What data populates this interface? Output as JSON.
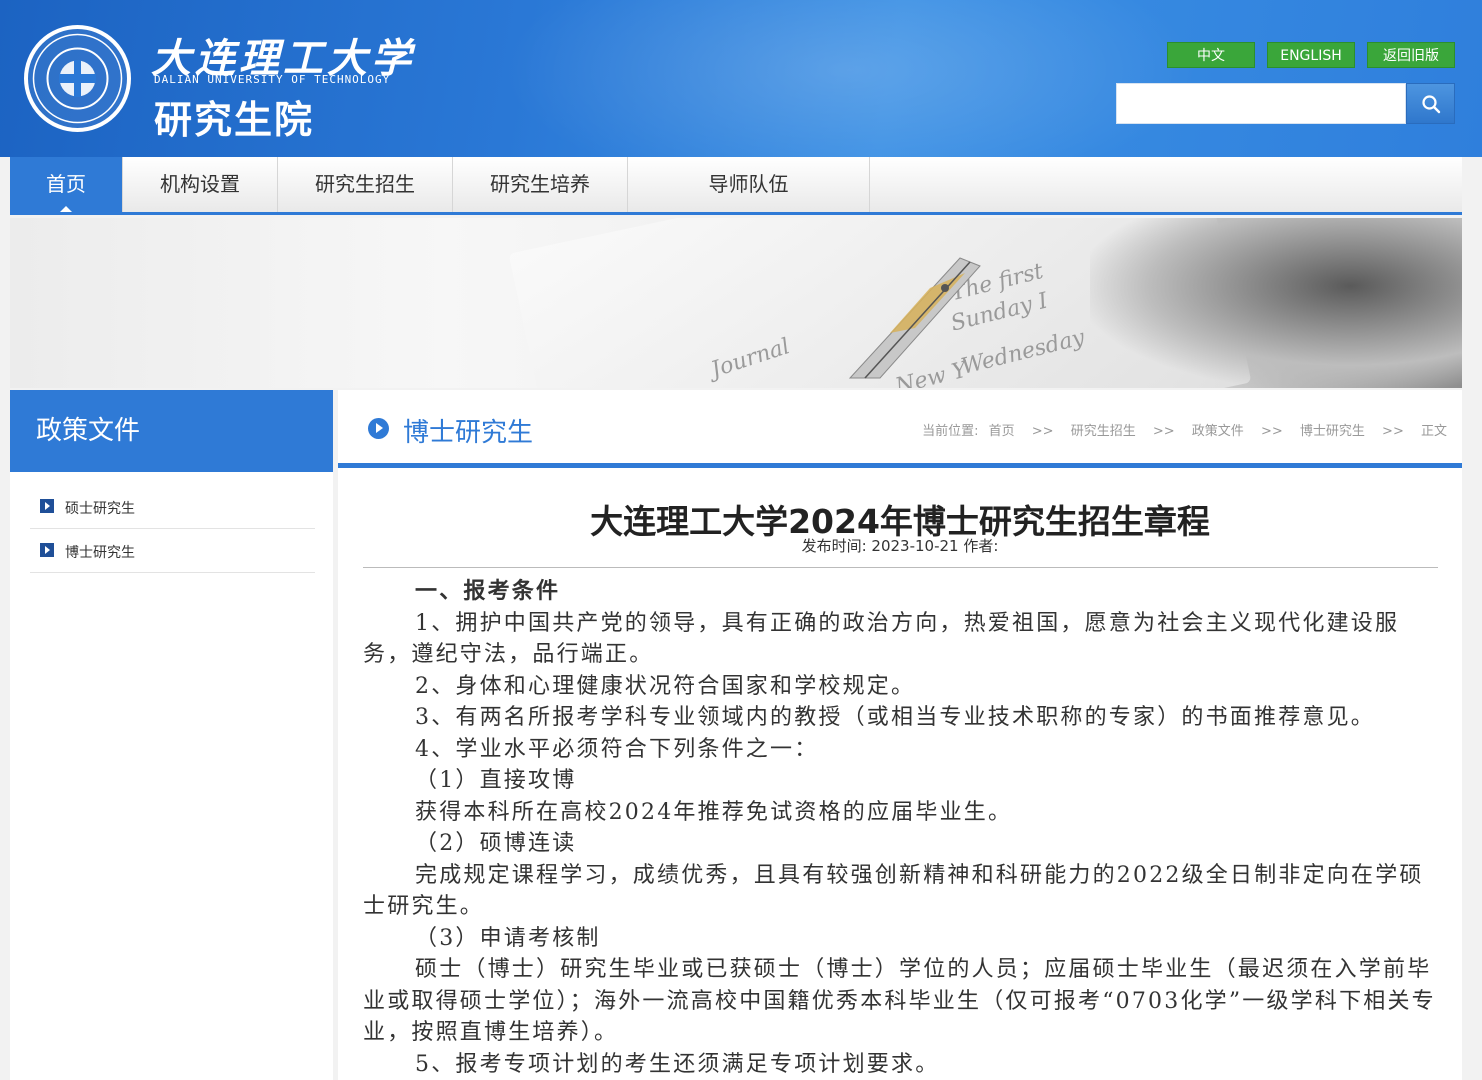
{
  "header": {
    "logo_cn": "大连理工大学",
    "logo_en": "DALIAN UNIVERSITY OF TECHNOLOGY",
    "logo_sub": "研究生院",
    "lang_cn": "中文",
    "lang_en": "ENGLISH",
    "lang_old": "返回旧版",
    "search_placeholder": ""
  },
  "nav": [
    "首页",
    "机构设置",
    "研究生招生",
    "研究生培养",
    "导师队伍"
  ],
  "banner": {
    "lines": [
      "The first",
      "Sunday I",
      "Journal",
      "Wednesday",
      "New Y"
    ]
  },
  "sidebar": {
    "title": "政策文件",
    "items": [
      "硕士研究生",
      "博士研究生"
    ]
  },
  "content": {
    "section_title": "博士研究生",
    "breadcrumb_label": "当前位置:",
    "breadcrumb": [
      "首页",
      "研究生招生",
      "政策文件",
      "博士研究生",
      "正文"
    ],
    "breadcrumb_sep": ">>",
    "article_title": "大连理工大学2024年博士研究生招生章程",
    "article_meta": "发布时间: 2023-10-21 作者:",
    "body": [
      "一、报考条件",
      "1、拥护中国共产党的领导，具有正确的政治方向，热爱祖国，愿意为社会主义现代化建设服务，遵纪守法，品行端正。",
      "2、身体和心理健康状况符合国家和学校规定。",
      "3、有两名所报考学科专业领域内的教授（或相当专业技术职称的专家）的书面推荐意见。",
      "4、学业水平必须符合下列条件之一：",
      "（1）直接攻博",
      "获得本科所在高校2024年推荐免试资格的应届毕业生。",
      "（2）硕博连读",
      "完成规定课程学习，成绩优秀，且具有较强创新精神和科研能力的2022级全日制非定向在学硕士研究生。",
      "（3）申请考核制",
      "硕士（博士）研究生毕业或已获硕士（博士）学位的人员；应届硕士毕业生（最迟须在入学前毕业或取得硕士学位）；海外一流高校中国籍优秀本科毕业生（仅可报考“0703化学”一级学科下相关专业，按照直博生培养）。",
      "5、报考专项计划的考生还须满足专项计划要求。"
    ]
  },
  "colors": {
    "primary": "#2f7ad6",
    "lang_green": "#3aa63a",
    "bullet_navy": "#1f4f98"
  }
}
